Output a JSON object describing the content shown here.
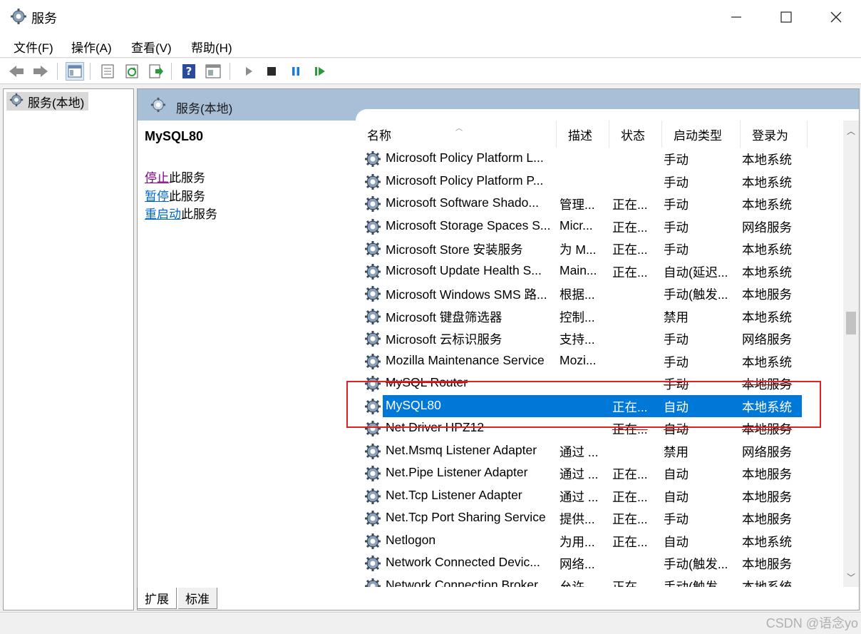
{
  "window": {
    "title": "服务"
  },
  "menu": [
    "文件(F)",
    "操作(A)",
    "查看(V)",
    "帮助(H)"
  ],
  "tree": {
    "item": "服务(本地)"
  },
  "pane": {
    "header": "服务(本地)",
    "selected_service": "MySQL80",
    "actions": [
      {
        "link": "停止",
        "suffix": "此服务"
      },
      {
        "link": "暂停",
        "suffix": "此服务"
      },
      {
        "link": "重启动",
        "suffix": "此服务"
      }
    ]
  },
  "columns": [
    "名称",
    "描述",
    "状态",
    "启动类型",
    "登录为"
  ],
  "rows": [
    {
      "name": "Microsoft Policy Platform L...",
      "desc": "",
      "status": "",
      "start": "手动",
      "logon": "本地系统"
    },
    {
      "name": "Microsoft Policy Platform P...",
      "desc": "",
      "status": "",
      "start": "手动",
      "logon": "本地系统"
    },
    {
      "name": "Microsoft Software Shado...",
      "desc": "管理...",
      "status": "正在...",
      "start": "手动",
      "logon": "本地系统"
    },
    {
      "name": "Microsoft Storage Spaces S...",
      "desc": "Micr...",
      "status": "正在...",
      "start": "手动",
      "logon": "网络服务"
    },
    {
      "name": "Microsoft Store 安装服务",
      "desc": "为 M...",
      "status": "正在...",
      "start": "手动",
      "logon": "本地系统"
    },
    {
      "name": "Microsoft Update Health S...",
      "desc": "Main...",
      "status": "正在...",
      "start": "自动(延迟...",
      "logon": "本地系统"
    },
    {
      "name": "Microsoft Windows SMS 路...",
      "desc": "根据...",
      "status": "",
      "start": "手动(触发...",
      "logon": "本地服务"
    },
    {
      "name": "Microsoft 键盘筛选器",
      "desc": "控制...",
      "status": "",
      "start": "禁用",
      "logon": "本地系统"
    },
    {
      "name": "Microsoft 云标识服务",
      "desc": "支持...",
      "status": "",
      "start": "手动",
      "logon": "网络服务"
    },
    {
      "name": "Mozilla Maintenance Service",
      "desc": "Mozi...",
      "status": "",
      "start": "手动",
      "logon": "本地系统"
    },
    {
      "name": "MySQL Router",
      "desc": "",
      "status": "",
      "start": "手动",
      "logon": "本地服务"
    },
    {
      "name": "MySQL80",
      "desc": "",
      "status": "正在...",
      "start": "自动",
      "logon": "本地系统"
    },
    {
      "name": "Net Driver HPZ12",
      "desc": "",
      "status": "正在...",
      "start": "自动",
      "logon": "本地服务"
    },
    {
      "name": "Net.Msmq Listener Adapter",
      "desc": "通过 ...",
      "status": "",
      "start": "禁用",
      "logon": "网络服务"
    },
    {
      "name": "Net.Pipe Listener Adapter",
      "desc": "通过 ...",
      "status": "正在...",
      "start": "自动",
      "logon": "本地服务"
    },
    {
      "name": "Net.Tcp Listener Adapter",
      "desc": "通过 ...",
      "status": "正在...",
      "start": "自动",
      "logon": "本地服务"
    },
    {
      "name": "Net.Tcp Port Sharing Service",
      "desc": "提供...",
      "status": "正在...",
      "start": "手动",
      "logon": "本地服务"
    },
    {
      "name": "Netlogon",
      "desc": "为用...",
      "status": "正在...",
      "start": "自动",
      "logon": "本地系统"
    },
    {
      "name": "Network Connected Devic...",
      "desc": "网络...",
      "status": "",
      "start": "手动(触发...",
      "logon": "本地服务"
    },
    {
      "name": "Network Connection Broker",
      "desc": "允许...",
      "status": "正在...",
      "start": "手动(触发...",
      "logon": "本地系统"
    }
  ],
  "selected_index": 11,
  "tabs": [
    "扩展",
    "标准"
  ],
  "watermark": "CSDN @语念yo",
  "colors": {
    "selection": "#0078d7",
    "header_band": "#a8bfd8",
    "highlight_box": "#e02020",
    "link": "#0066cc",
    "visited_link": "#800080"
  }
}
